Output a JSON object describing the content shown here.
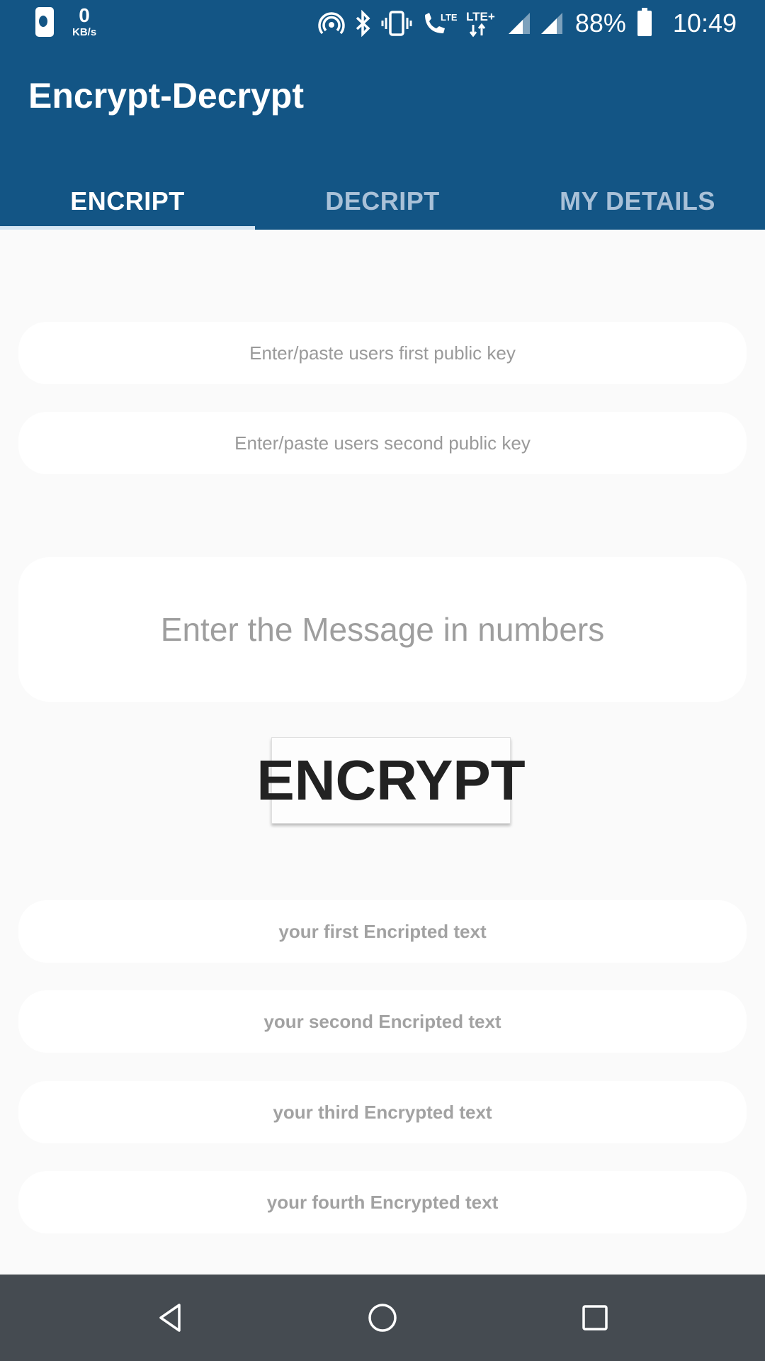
{
  "status_bar": {
    "net_speed_value": "0",
    "net_speed_unit": "KB/s",
    "battery_percent": "88%",
    "time": "10:49",
    "icons": [
      "phone-icon",
      "hotspot-icon",
      "bluetooth-icon",
      "vibrate-icon",
      "volte-call-icon",
      "lte-plus-icon",
      "signal-icon",
      "signal-icon",
      "battery-icon"
    ]
  },
  "app_bar": {
    "title": "Encrypt-Decrypt"
  },
  "tabs": [
    {
      "label": "ENCRIPT",
      "active": true
    },
    {
      "label": "DECRIPT",
      "active": false
    },
    {
      "label": "MY DETAILS",
      "active": false
    }
  ],
  "form": {
    "first_key_placeholder": "Enter/paste users first public key",
    "second_key_placeholder": "Enter/paste users second public key",
    "message_placeholder": "Enter the Message in numbers",
    "encrypt_button": "ENCRYPT",
    "outputs": [
      "your first Encripted text",
      "your second Encripted text",
      "your third Encrypted text",
      "your fourth Encrypted text"
    ]
  },
  "nav_bar": {
    "icons": [
      "back-icon",
      "home-icon",
      "recents-icon"
    ]
  },
  "colors": {
    "primary": "#135585",
    "tab_inactive": "#a9c1d8",
    "background": "#fafafa",
    "nav_bar": "#454b51"
  }
}
